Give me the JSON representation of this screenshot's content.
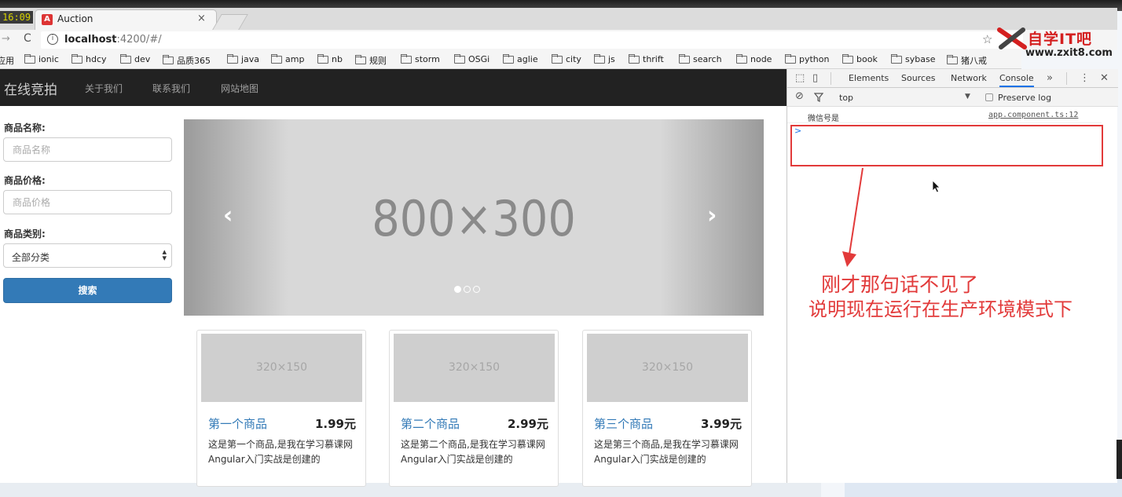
{
  "window": {
    "clock": "16:09",
    "tab_title": "Auction",
    "tab_close": "×",
    "url_host": "localhost",
    "url_rest": ":4200/#/"
  },
  "watermark": {
    "brand": "自学IT吧",
    "url": "www.zxit8.com"
  },
  "bookmarks": [
    "应用",
    "ionic",
    "hdcy",
    "dev",
    "品质365",
    "java",
    "amp",
    "nb",
    "规则",
    "storm",
    "OSGi",
    "aglie",
    "city",
    "js",
    "thrift",
    "search",
    "node",
    "python",
    "book",
    "sybase",
    "猪八戒"
  ],
  "navbar": {
    "brand": "在线竞拍",
    "links": [
      "关于我们",
      "联系我们",
      "网站地图"
    ]
  },
  "search_form": {
    "name_label": "商品名称:",
    "name_placeholder": "商品名称",
    "price_label": "商品价格:",
    "price_placeholder": "商品价格",
    "category_label": "商品类别:",
    "category_value": "全部分类",
    "search_button": "搜索"
  },
  "carousel": {
    "placeholder": "800×300",
    "prev": "‹",
    "next": "›",
    "slide_count": 3,
    "active_index": 0
  },
  "products": [
    {
      "image": "320×150",
      "title": "第一个商品",
      "price": "1.99元",
      "desc": "这是第一个商品,是我在学习慕课网Angular入门实战是创建的"
    },
    {
      "image": "320×150",
      "title": "第二个商品",
      "price": "2.99元",
      "desc": "这是第二个商品,是我在学习慕课网Angular入门实战是创建的"
    },
    {
      "image": "320×150",
      "title": "第三个商品",
      "price": "3.99元",
      "desc": "这是第三个商品,是我在学习慕课网Angular入门实战是创建的"
    }
  ],
  "devtools": {
    "tabs": [
      "Elements",
      "Sources",
      "Network",
      "Console"
    ],
    "active_tab": "Console",
    "more": "»",
    "context": "top",
    "preserve_log": "Preserve log",
    "log_message": "微信号是",
    "log_source": "app.component.ts:12",
    "prompt": ">"
  },
  "annotation": {
    "line1": "刚才那句话不见了",
    "line2": "说明现在运行在生产环境模式下",
    "color": "#e23a3a"
  },
  "colors": {
    "navbar_bg": "#222222",
    "primary_button": "#337ab7",
    "annotation_red": "#e23a3a"
  }
}
